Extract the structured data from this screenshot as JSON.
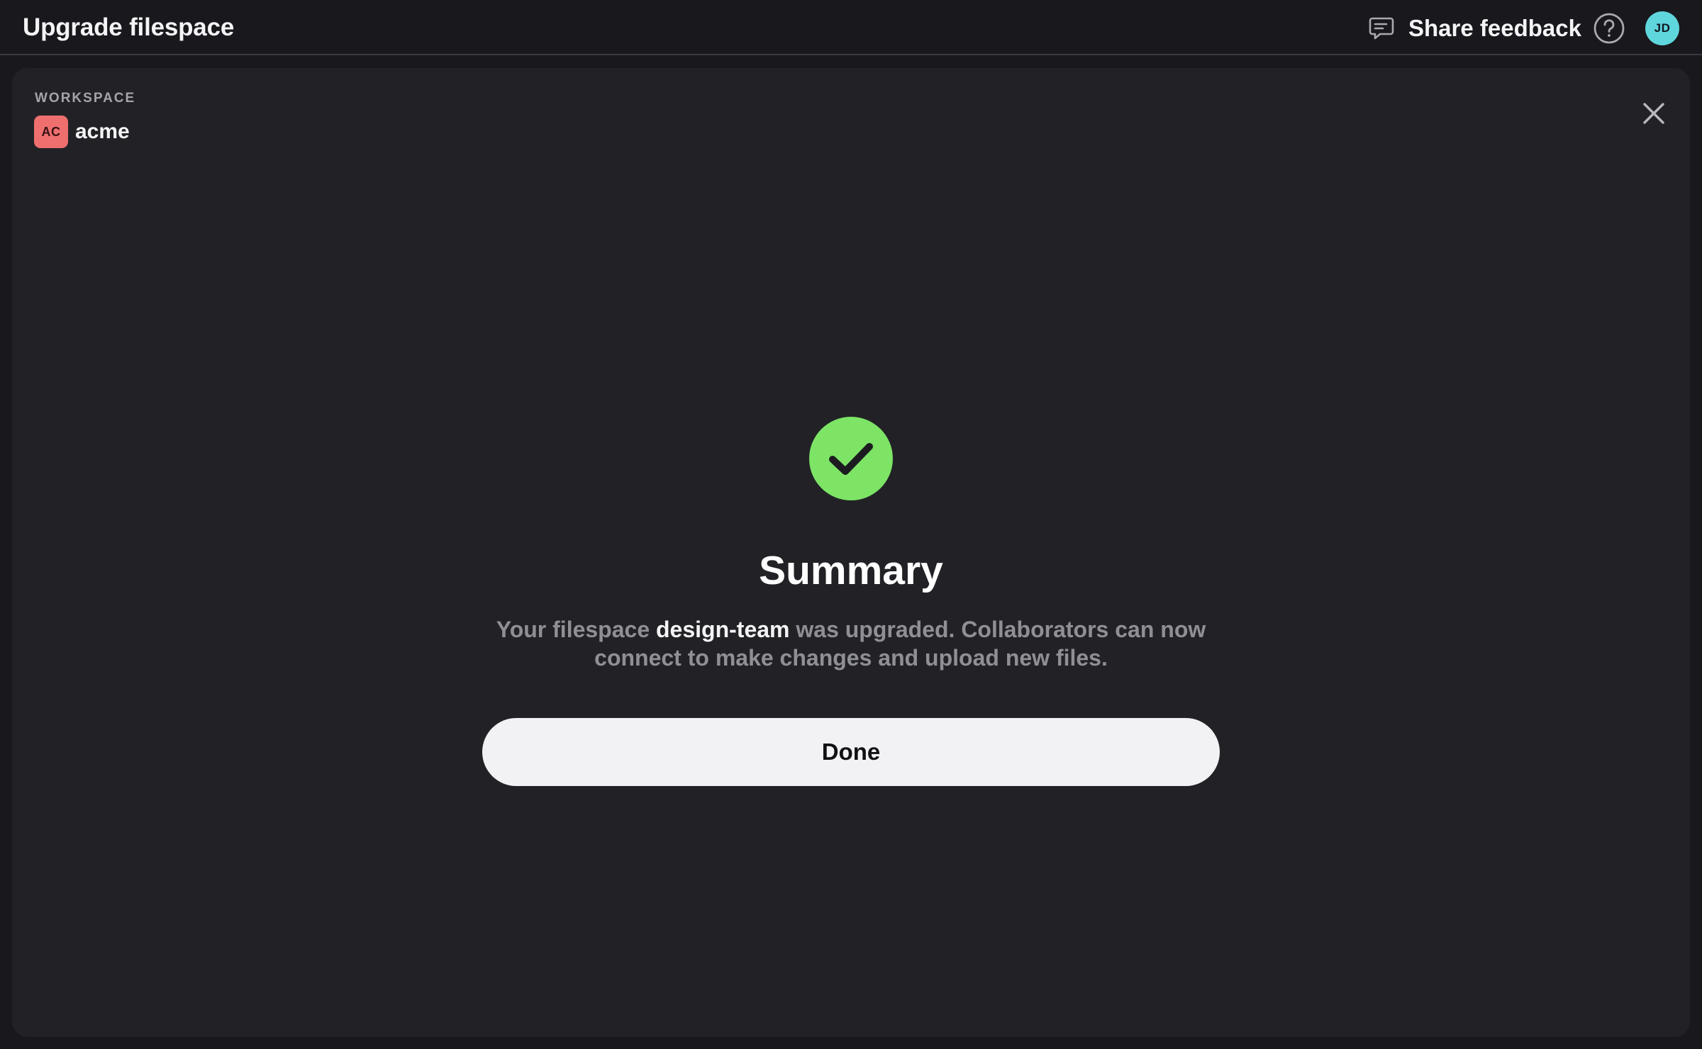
{
  "header": {
    "title": "Upgrade filespace",
    "feedback_label": "Share feedback",
    "feedback_icon": "chat-bubble-icon",
    "help_icon": "question-circle-icon",
    "avatar_initials": "JD",
    "avatar_color": "#5fd6dc"
  },
  "workspace": {
    "label": "WORKSPACE",
    "badge": "AC",
    "badge_color": "#ef6f6f",
    "name": "acme"
  },
  "dialog": {
    "close_icon": "close-icon",
    "status_icon": "check-circle-icon",
    "status_color": "#7de466",
    "title": "Summary",
    "message_prefix": "Your filespace",
    "filespace_name": "design-team",
    "message_suffix": "was upgraded. Collaborators can now connect to make changes and upload new files.",
    "done_label": "Done"
  }
}
